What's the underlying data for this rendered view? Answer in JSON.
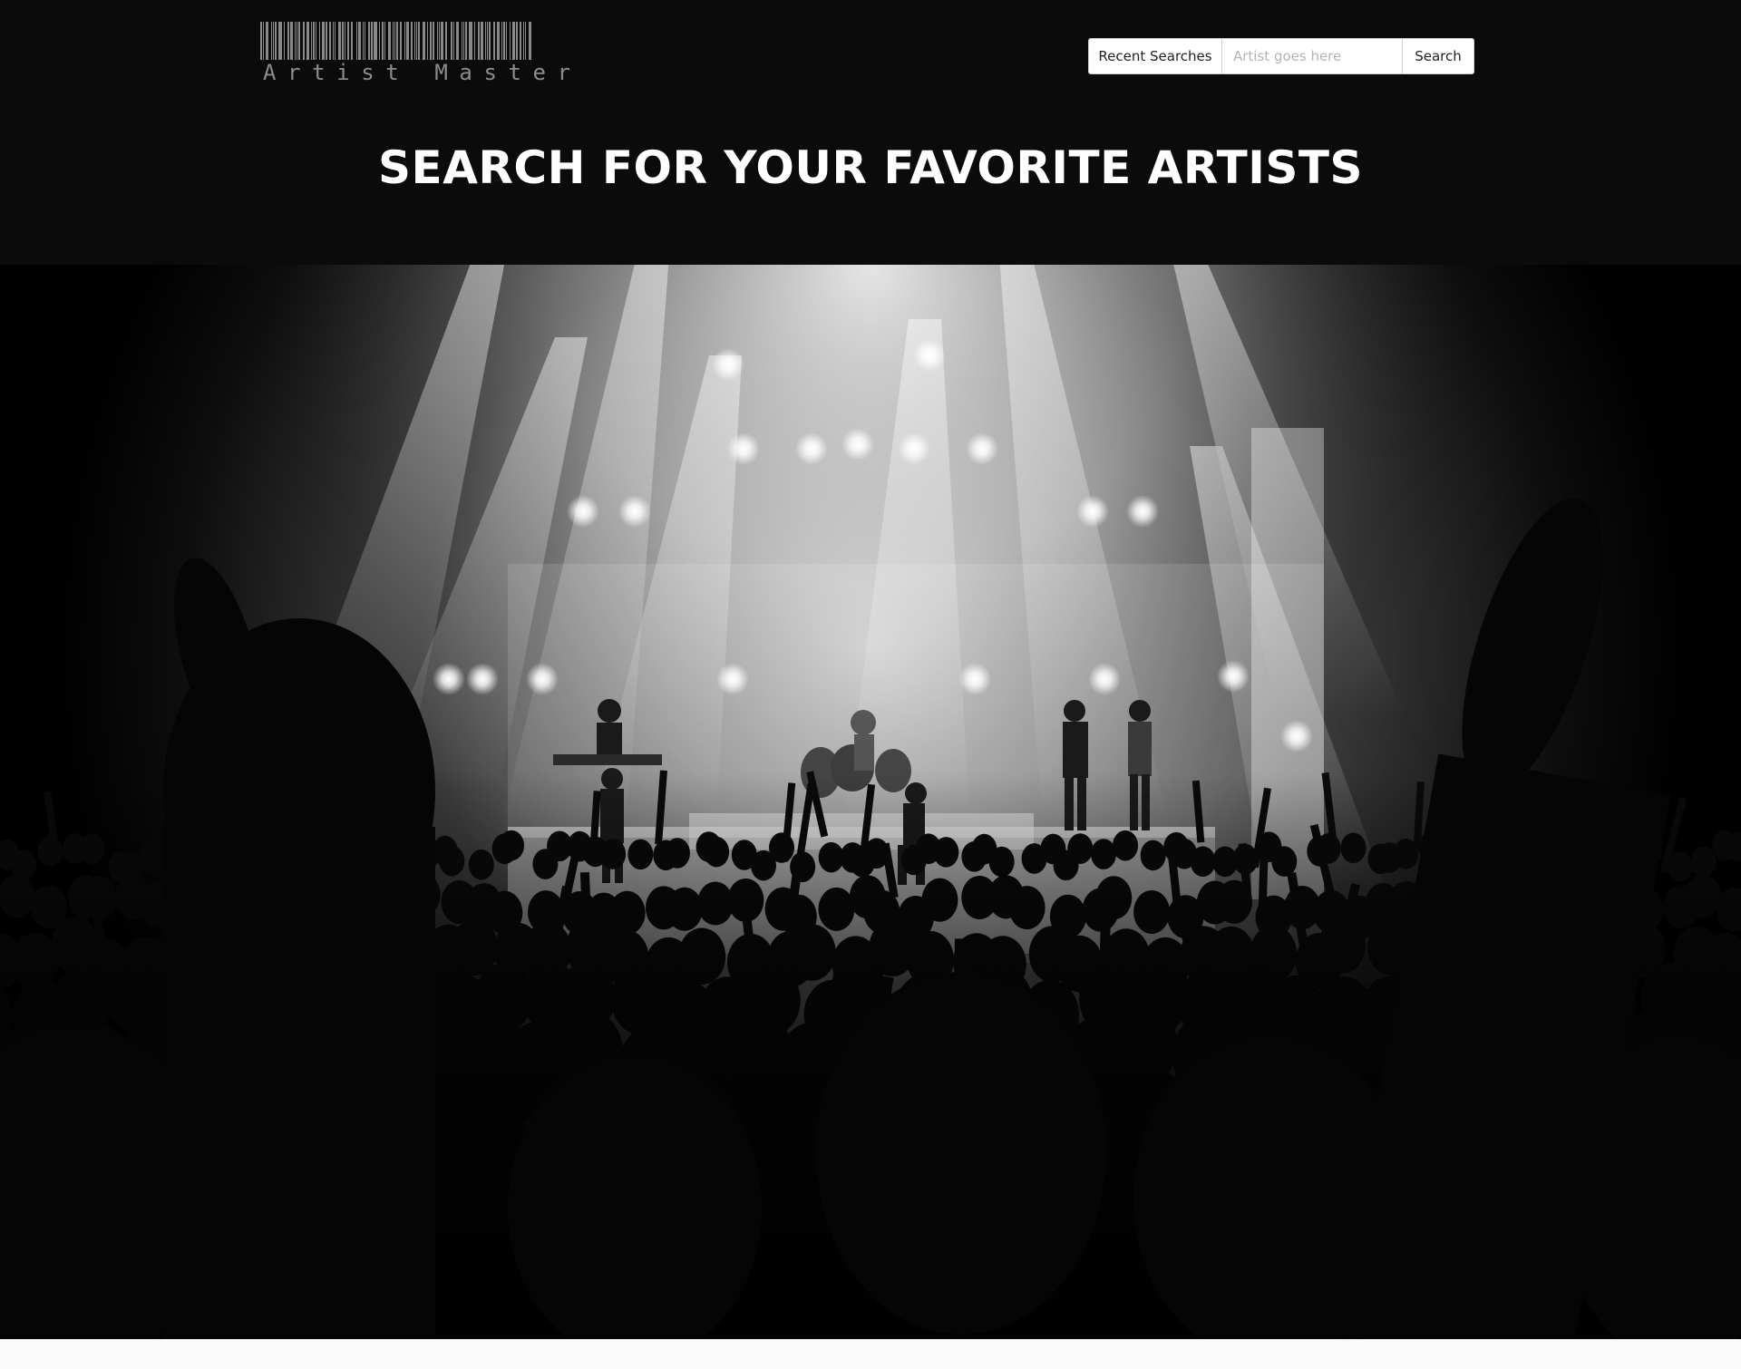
{
  "brand": {
    "logo_text": "Artist Master"
  },
  "header": {
    "recent_searches_label": "Recent Searches",
    "artist_input_placeholder": "Artist goes here",
    "artist_input_value": "",
    "search_button_label": "Search",
    "headline": "SEARCH FOR YOUR FAVORITE ARTISTS"
  },
  "colors": {
    "header_background": "#0b0b0b",
    "headline_text": "#ffffff",
    "logo_text": "#8c8c8c"
  }
}
